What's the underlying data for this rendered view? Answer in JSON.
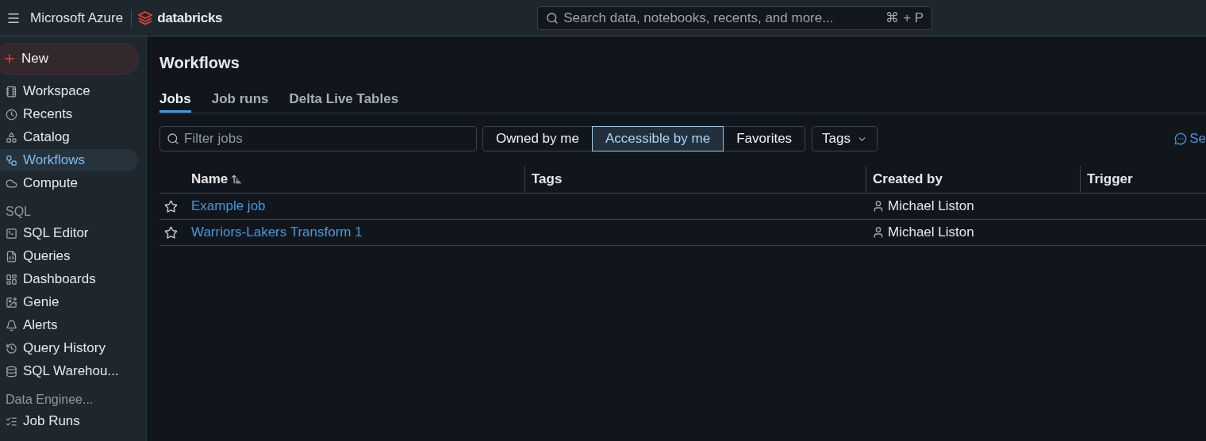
{
  "topbar": {
    "brand": "Microsoft Azure",
    "product": "databricks",
    "search": {
      "placeholder": "Search data, notebooks, recents, and more...",
      "shortcut": "⌘ + P"
    }
  },
  "sidebar": {
    "new_button": "New",
    "items": [
      {
        "label": "Workspace",
        "selected": false
      },
      {
        "label": "Recents",
        "selected": false
      },
      {
        "label": "Catalog",
        "selected": false
      },
      {
        "label": "Workflows",
        "selected": true
      },
      {
        "label": "Compute",
        "selected": false
      }
    ],
    "sections": [
      {
        "title": "SQL",
        "items": [
          {
            "label": "SQL Editor",
            "selected": false
          },
          {
            "label": "Queries",
            "selected": false
          },
          {
            "label": "Dashboards",
            "selected": false
          },
          {
            "label": "Genie",
            "selected": false
          },
          {
            "label": "Alerts",
            "selected": false
          },
          {
            "label": "Query History",
            "selected": false
          },
          {
            "label": "SQL Warehou...",
            "selected": false
          }
        ]
      },
      {
        "title": "Data Enginee...",
        "items": [
          {
            "label": "Job Runs",
            "selected": false
          }
        ]
      }
    ]
  },
  "page": {
    "title": "Workflows",
    "tabs": [
      {
        "label": "Jobs",
        "selected": true
      },
      {
        "label": "Job runs",
        "selected": false
      },
      {
        "label": "Delta Live Tables",
        "selected": false
      }
    ],
    "filter": {
      "placeholder": "Filter jobs"
    },
    "scope": [
      {
        "label": "Owned by me",
        "selected": false
      },
      {
        "label": "Accessible by me",
        "selected": true
      },
      {
        "label": "Favorites",
        "selected": false
      }
    ],
    "tags_dropdown": "Tags",
    "feedback_link": "Se",
    "table": {
      "columns": [
        "Name",
        "Tags",
        "Created by",
        "Trigger"
      ],
      "rows": [
        {
          "name": "Example job",
          "favorite": false,
          "created_by": "Michael Liston"
        },
        {
          "name": "Warriors-Lakers Transform 1",
          "favorite": false,
          "created_by": "Michael Liston"
        }
      ]
    }
  }
}
